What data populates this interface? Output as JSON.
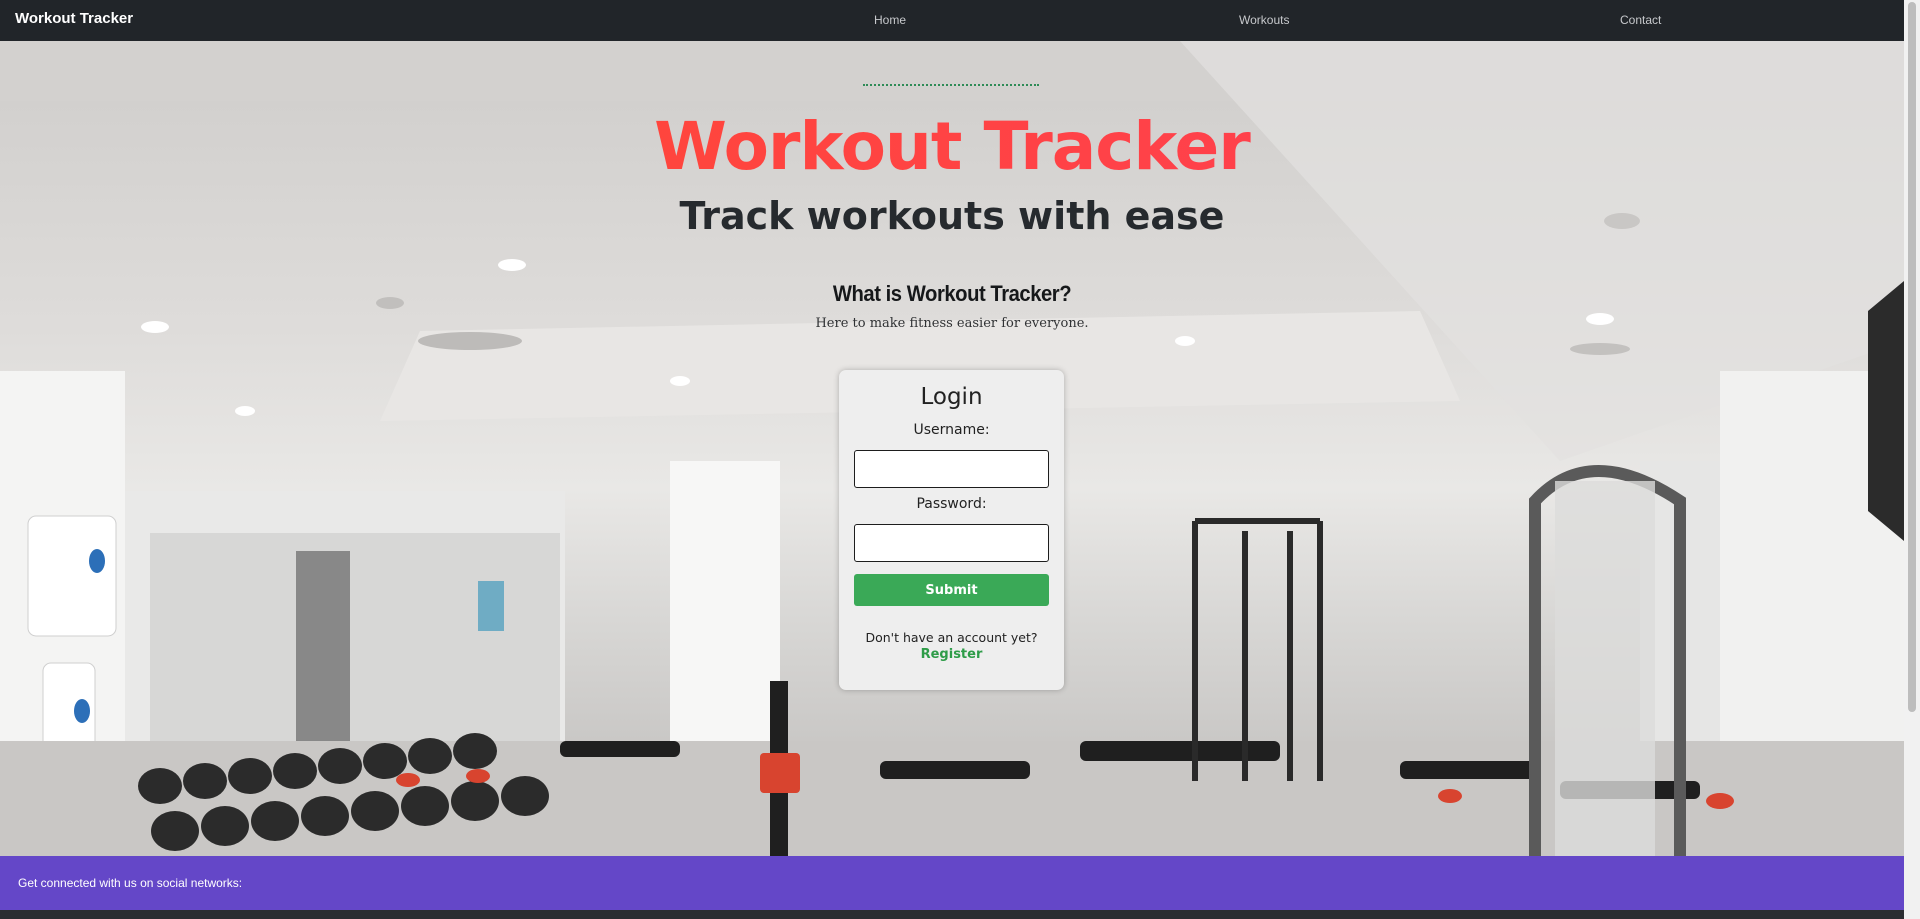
{
  "navbar": {
    "brand": "Workout Tracker",
    "links": [
      "Home",
      "Workouts",
      "Contact"
    ]
  },
  "hero": {
    "title": "Workout Tracker",
    "subtitle": "Track workouts with ease",
    "what_heading": "What is Workout Tracker?",
    "what_text": "Here to make fitness easier for everyone."
  },
  "login": {
    "title": "Login",
    "username_label": "Username:",
    "password_label": "Password:",
    "username_value": "",
    "password_value": "",
    "submit_label": "Submit",
    "no_account_text": "Don't have an account yet?",
    "register_label": "Register"
  },
  "footer": {
    "social_text": "Get connected with us on social networks:"
  },
  "colors": {
    "navbar_bg": "#212529",
    "title_gradient_start": "#ff4a2e",
    "title_gradient_end": "#ff3c5a",
    "submit_bg": "#3aa957",
    "register_color": "#2e9c48",
    "footer_bg": "#6447c8"
  }
}
